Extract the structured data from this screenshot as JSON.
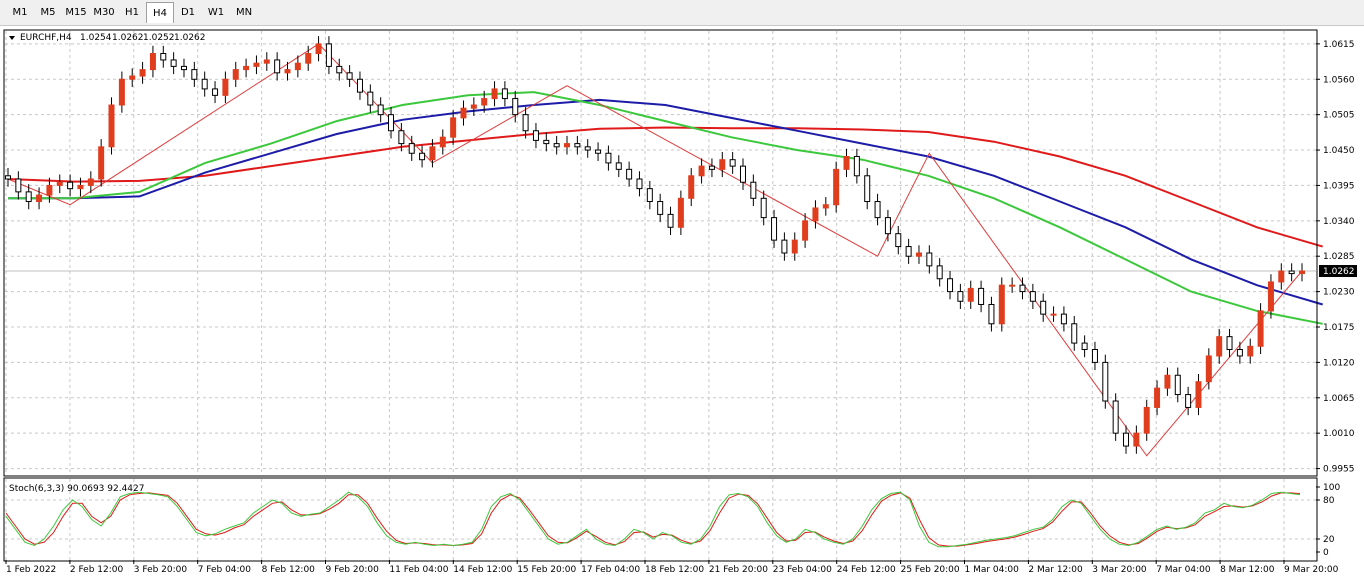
{
  "timeframes": [
    "M1",
    "M5",
    "M15",
    "M30",
    "H1",
    "H4",
    "D1",
    "W1",
    "MN"
  ],
  "active_timeframe": "H4",
  "chart_header": {
    "symbol": "EURCHF,H4",
    "open": "1.0254",
    "high": "1.0262",
    "low": "1.0252",
    "close": "1.0262"
  },
  "indicator_label": "Stoch(6,3,3) 90.0693 92.4427",
  "current_price_label": "1.0262",
  "colors": {
    "bull": "#e03c1e",
    "bear": "#ffffff",
    "ma_red": "#e01a1a",
    "ma_blue": "#1c1ca8",
    "ma_green": "#3cc83c",
    "zigzag": "#e03c3c",
    "stoch_main": "#3cc83c",
    "stoch_signal": "#e01a1a",
    "grid": "#c8c8c8"
  },
  "chart_data": {
    "type": "candlestick",
    "price_ticks": [
      "1.0615",
      "1.0560",
      "1.0505",
      "1.0450",
      "1.0395",
      "1.0340",
      "1.0285",
      "1.0230",
      "1.0175",
      "1.0120",
      "1.0065",
      "1.0010",
      "0.9955"
    ],
    "price_range": [
      0.9945,
      1.0635
    ],
    "time_labels": [
      "1 Feb 2022",
      "2 Feb 12:00",
      "3 Feb 20:00",
      "7 Feb 04:00",
      "8 Feb 12:00",
      "9 Feb 20:00",
      "11 Feb 04:00",
      "14 Feb 12:00",
      "15 Feb 20:00",
      "17 Feb 04:00",
      "18 Feb 12:00",
      "21 Feb 20:00",
      "23 Feb 04:00",
      "24 Feb 12:00",
      "25 Feb 20:00",
      "1 Mar 04:00",
      "2 Mar 12:00",
      "3 Mar 20:00",
      "7 Mar 04:00",
      "8 Mar 12:00",
      "9 Mar 20:00"
    ],
    "closes": [
      1.0405,
      1.0385,
      1.037,
      1.038,
      1.0395,
      1.04,
      1.039,
      1.0395,
      1.0405,
      1.0455,
      1.052,
      1.056,
      1.0565,
      1.0575,
      1.06,
      1.059,
      1.058,
      1.0575,
      1.056,
      1.0545,
      1.0535,
      1.056,
      1.0575,
      1.058,
      1.0585,
      1.059,
      1.057,
      1.0575,
      1.0585,
      1.06,
      1.0615,
      1.058,
      1.057,
      1.056,
      1.054,
      1.052,
      1.0505,
      1.048,
      1.046,
      1.0445,
      1.0435,
      1.0455,
      1.047,
      1.05,
      1.0515,
      1.052,
      1.053,
      1.0545,
      1.053,
      1.0505,
      1.048,
      1.0465,
      1.046,
      1.0455,
      1.046,
      1.0455,
      1.045,
      1.0445,
      1.043,
      1.042,
      1.0405,
      1.039,
      1.037,
      1.035,
      1.033,
      1.0375,
      1.041,
      1.0425,
      1.042,
      1.0435,
      1.0425,
      1.04,
      1.0375,
      1.0345,
      1.031,
      1.029,
      1.031,
      1.034,
      1.036,
      1.0365,
      1.042,
      1.044,
      1.041,
      1.037,
      1.0345,
      1.032,
      1.03,
      1.0285,
      1.029,
      1.027,
      1.025,
      1.023,
      1.0215,
      1.0235,
      1.021,
      1.018,
      1.024,
      1.024,
      1.023,
      1.0215,
      1.0195,
      1.0195,
      1.018,
      1.015,
      1.014,
      1.012,
      1.006,
      1.001,
      0.999,
      1.001,
      1.005,
      1.008,
      1.01,
      1.007,
      1.005,
      1.009,
      1.013,
      1.016,
      1.014,
      1.013,
      1.0145,
      1.02,
      1.0245,
      1.0262,
      1.0258,
      1.0262
    ],
    "ma_red": {
      "from": 0,
      "to": 127,
      "values": [
        1.0405,
        1.0401,
        1.0402,
        1.041,
        1.0425,
        1.044,
        1.0455,
        1.0465,
        1.0475,
        1.0483,
        1.0485,
        1.0484,
        1.0484,
        1.0482,
        1.0478,
        1.0463,
        1.044,
        1.041,
        1.037,
        1.033,
        1.03
      ]
    },
    "ma_blue": {
      "from": 0,
      "to": 127,
      "values": [
        1.0375,
        1.0375,
        1.0378,
        1.0415,
        1.0445,
        1.0475,
        1.0497,
        1.051,
        1.052,
        1.0528,
        1.052,
        1.05,
        1.048,
        1.046,
        1.044,
        1.041,
        1.037,
        1.033,
        1.028,
        1.024,
        1.021
      ]
    },
    "ma_green": {
      "from": 0,
      "to": 127,
      "values": [
        1.0375,
        1.0375,
        1.0385,
        1.043,
        1.046,
        1.0495,
        1.052,
        1.0535,
        1.054,
        1.052,
        1.0495,
        1.047,
        1.045,
        1.0435,
        1.041,
        1.0375,
        1.033,
        1.028,
        1.023,
        1.02,
        1.018
      ]
    },
    "zigzag_points": [
      [
        0,
        1.0405
      ],
      [
        6,
        1.0365
      ],
      [
        30,
        1.0615
      ],
      [
        41,
        1.043
      ],
      [
        54,
        1.055
      ],
      [
        84,
        1.0285
      ],
      [
        89,
        1.0445
      ],
      [
        110,
        0.9975
      ],
      [
        125,
        1.0262
      ]
    ],
    "stochastic": {
      "ticks": [
        "100",
        "80",
        "20",
        "0"
      ],
      "range": [
        0,
        100
      ],
      "main": [
        55,
        35,
        15,
        10,
        20,
        40,
        65,
        80,
        70,
        50,
        40,
        60,
        85,
        90,
        92,
        90,
        88,
        85,
        70,
        50,
        30,
        25,
        28,
        35,
        40,
        45,
        60,
        70,
        80,
        75,
        60,
        55,
        58,
        60,
        70,
        80,
        92,
        85,
        70,
        45,
        25,
        15,
        12,
        15,
        12,
        10,
        12,
        10,
        12,
        15,
        35,
        70,
        85,
        90,
        80,
        60,
        40,
        20,
        12,
        15,
        25,
        35,
        20,
        12,
        10,
        20,
        35,
        30,
        20,
        30,
        25,
        15,
        12,
        20,
        40,
        70,
        88,
        90,
        85,
        70,
        45,
        25,
        15,
        20,
        35,
        30,
        20,
        15,
        12,
        20,
        40,
        65,
        82,
        90,
        92,
        80,
        40,
        15,
        8,
        8,
        10,
        12,
        15,
        18,
        20,
        22,
        25,
        30,
        35,
        38,
        50,
        70,
        80,
        75,
        55,
        35,
        20,
        12,
        10,
        15,
        25,
        35,
        40,
        35,
        38,
        45,
        60,
        65,
        75,
        70,
        68,
        72,
        80,
        90,
        92,
        90,
        88
      ],
      "signal": [
        60,
        40,
        20,
        12,
        15,
        30,
        55,
        75,
        75,
        55,
        45,
        55,
        80,
        88,
        90,
        91,
        89,
        87,
        75,
        55,
        35,
        28,
        26,
        30,
        37,
        42,
        55,
        65,
        75,
        77,
        65,
        57,
        57,
        59,
        66,
        75,
        88,
        88,
        75,
        52,
        32,
        18,
        13,
        14,
        13,
        11,
        11,
        10,
        11,
        13,
        28,
        60,
        80,
        88,
        83,
        65,
        45,
        25,
        15,
        14,
        22,
        32,
        24,
        15,
        11,
        16,
        30,
        31,
        23,
        27,
        26,
        18,
        13,
        17,
        33,
        60,
        83,
        89,
        87,
        74,
        52,
        30,
        17,
        18,
        30,
        31,
        23,
        17,
        13,
        17,
        33,
        57,
        78,
        87,
        91,
        83,
        50,
        22,
        11,
        9,
        9,
        11,
        13,
        16,
        18,
        20,
        23,
        27,
        32,
        36,
        46,
        63,
        77,
        77,
        60,
        40,
        25,
        15,
        11,
        13,
        22,
        32,
        38,
        36,
        37,
        42,
        55,
        62,
        70,
        71,
        69,
        71,
        77,
        86,
        91,
        91,
        90
      ]
    }
  }
}
